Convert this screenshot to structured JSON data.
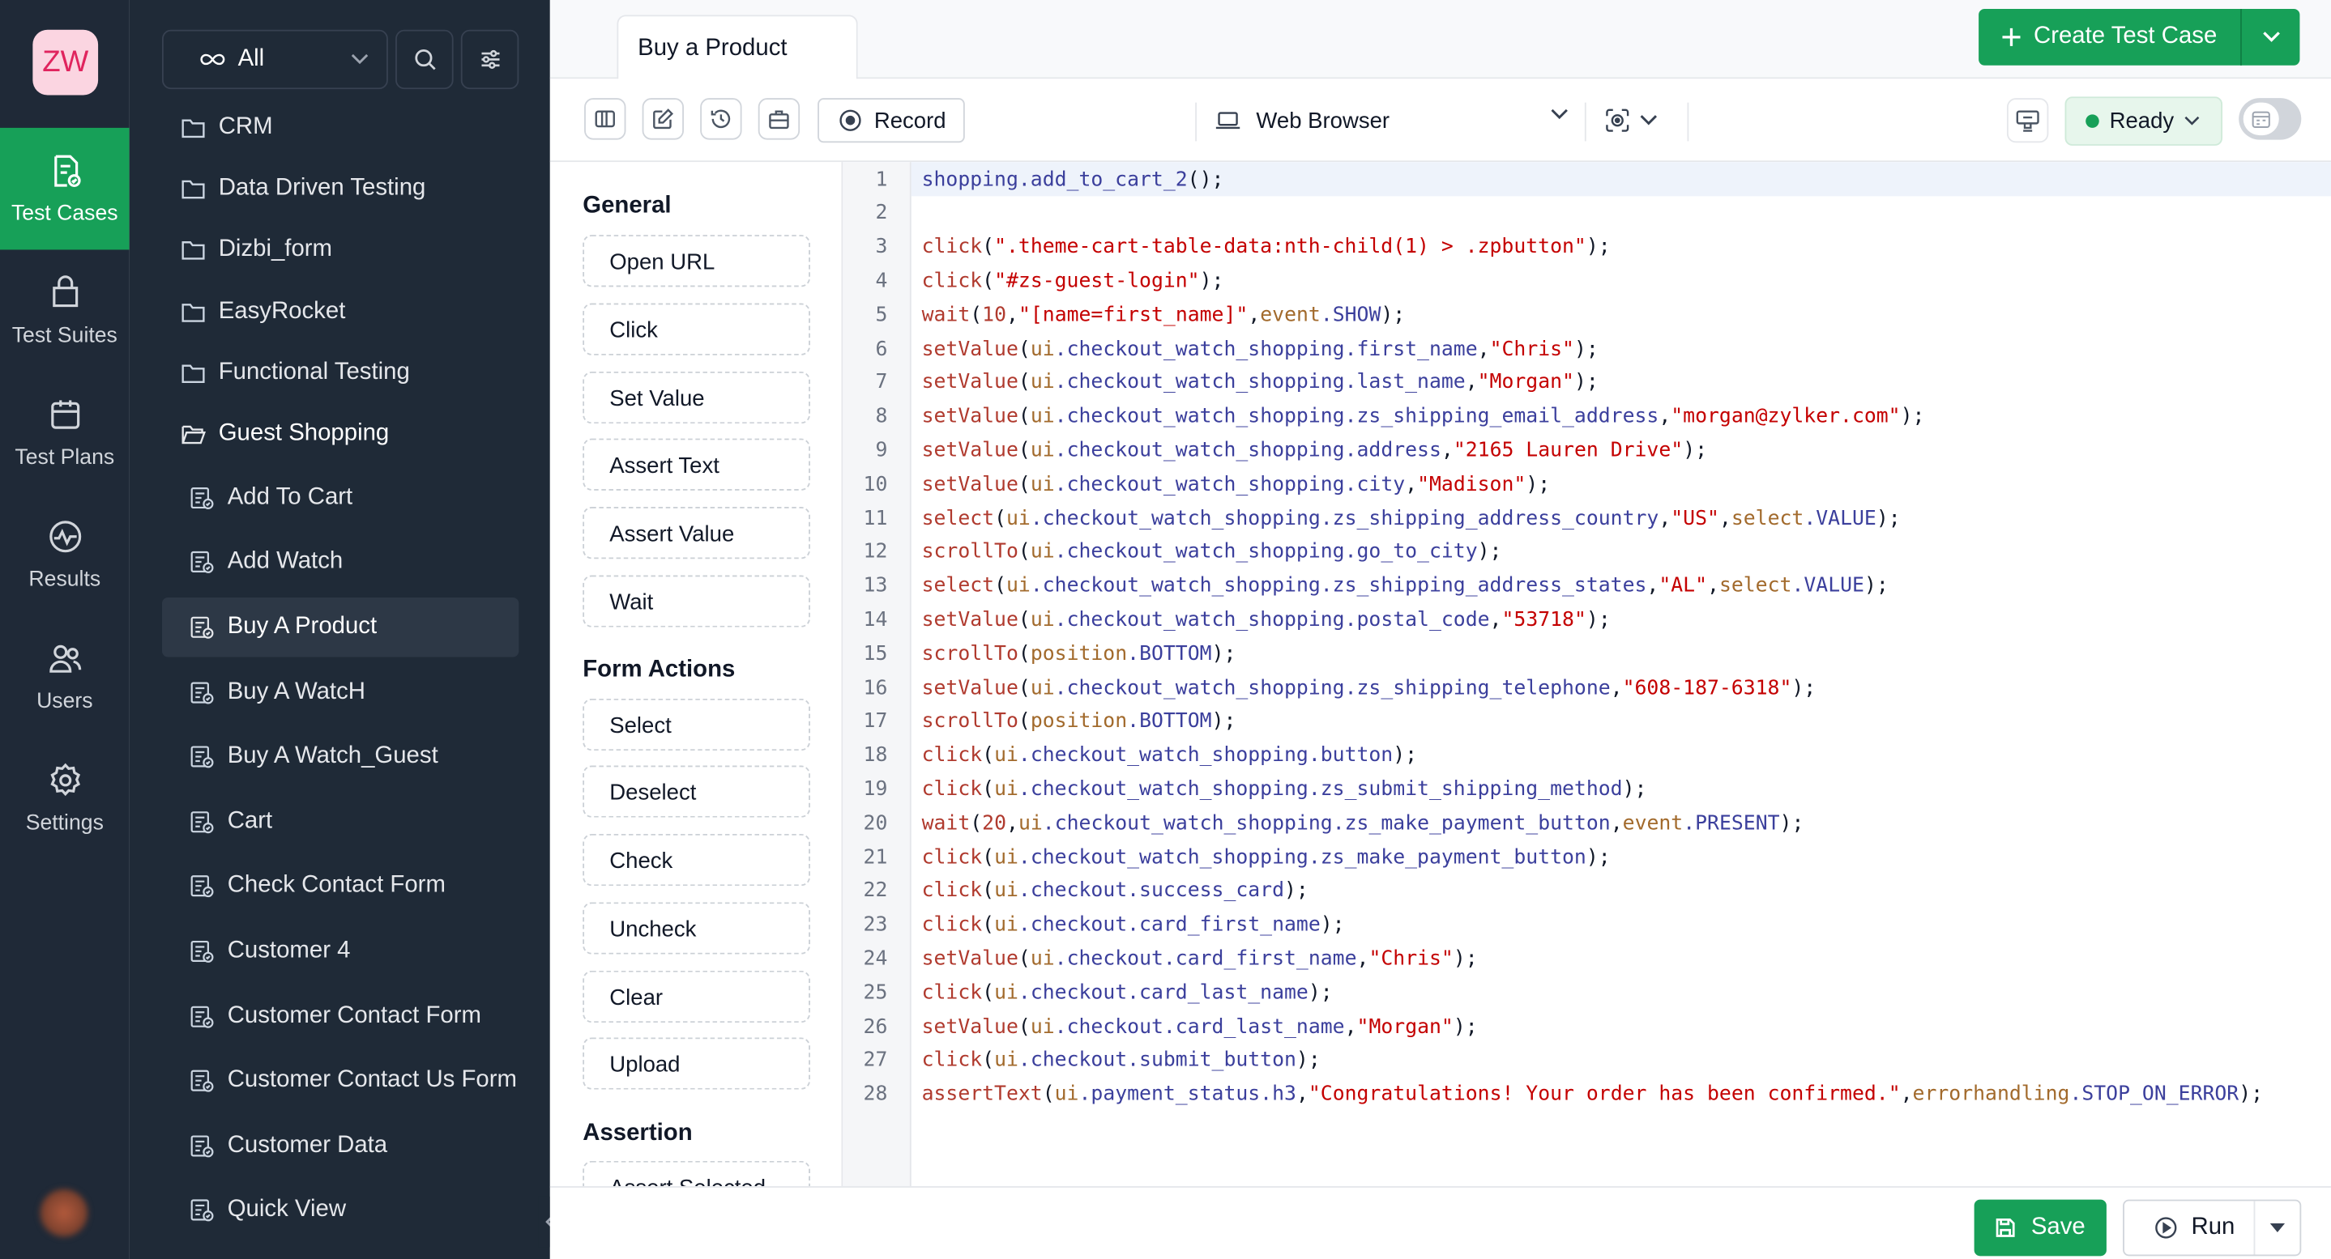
{
  "rail": {
    "logo_text": "ZW",
    "items": [
      {
        "label": "Test Cases",
        "icon": "test-cases-icon",
        "active": true
      },
      {
        "label": "Test Suites",
        "icon": "test-suites-icon",
        "active": false
      },
      {
        "label": "Test Plans",
        "icon": "test-plans-icon",
        "active": false
      },
      {
        "label": "Results",
        "icon": "results-icon",
        "active": false
      },
      {
        "label": "Users",
        "icon": "users-icon",
        "active": false
      },
      {
        "label": "Settings",
        "icon": "settings-icon",
        "active": false
      }
    ]
  },
  "tree": {
    "filter_label": "All",
    "folders": [
      {
        "label": "CRM",
        "open": false
      },
      {
        "label": "Data Driven Testing",
        "open": false
      },
      {
        "label": "Dizbi_form",
        "open": false
      },
      {
        "label": "EasyRocket",
        "open": false
      },
      {
        "label": "Functional Testing",
        "open": false
      },
      {
        "label": "Guest Shopping",
        "open": true
      }
    ],
    "cases": [
      {
        "label": "Add To Cart",
        "selected": false
      },
      {
        "label": "Add Watch",
        "selected": false
      },
      {
        "label": "Buy A Product",
        "selected": true
      },
      {
        "label": "Buy A WatcH",
        "selected": false
      },
      {
        "label": "Buy A Watch_Guest",
        "selected": false
      },
      {
        "label": "Cart",
        "selected": false
      },
      {
        "label": "Check Contact Form",
        "selected": false
      },
      {
        "label": "Customer 4",
        "selected": false
      },
      {
        "label": "Customer Contact Form",
        "selected": false
      },
      {
        "label": "Customer Contact Us Form",
        "selected": false
      },
      {
        "label": "Customer Data",
        "selected": false
      },
      {
        "label": "Quick View",
        "selected": false
      }
    ]
  },
  "header": {
    "tab_label": "Buy a Product",
    "create_label": "Create Test Case"
  },
  "toolbar": {
    "record_label": "Record",
    "browser_label": "Web Browser",
    "status_label": "Ready"
  },
  "palette": {
    "groups": [
      {
        "title": "General",
        "items": [
          "Open URL",
          "Click",
          "Set Value",
          "Assert Text",
          "Assert Value",
          "Wait"
        ]
      },
      {
        "title": "Form Actions",
        "items": [
          "Select",
          "Deselect",
          "Check",
          "Uncheck",
          "Clear",
          "Upload"
        ]
      },
      {
        "title": "Assertion",
        "items": [
          "Assert Selected"
        ]
      }
    ]
  },
  "editor": {
    "lines": [
      [
        [
          "shopping.add_to_cart_2",
          "p"
        ],
        [
          "();",
          "d"
        ]
      ],
      [],
      [
        [
          "click",
          "f"
        ],
        [
          "(",
          "d"
        ],
        [
          "\".theme-cart-table-data:nth-child(1) > .zpbutton\"",
          "s"
        ],
        [
          ");",
          "d"
        ]
      ],
      [
        [
          "click",
          "f"
        ],
        [
          "(",
          "d"
        ],
        [
          "\"#zs-guest-login\"",
          "s"
        ],
        [
          ");",
          "d"
        ]
      ],
      [
        [
          "wait",
          "f"
        ],
        [
          "(",
          "d"
        ],
        [
          "10",
          "n"
        ],
        [
          ",",
          "d"
        ],
        [
          "\"[name=first_name]\"",
          "s"
        ],
        [
          ",",
          "d"
        ],
        [
          "event",
          "o"
        ],
        [
          ".SHOW",
          "p"
        ],
        [
          ");",
          "d"
        ]
      ],
      [
        [
          "setValue",
          "f"
        ],
        [
          "(",
          "d"
        ],
        [
          "ui",
          "o"
        ],
        [
          ".checkout_watch_shopping.first_name",
          "p"
        ],
        [
          ",",
          "d"
        ],
        [
          "\"Chris\"",
          "s"
        ],
        [
          ");",
          "d"
        ]
      ],
      [
        [
          "setValue",
          "f"
        ],
        [
          "(",
          "d"
        ],
        [
          "ui",
          "o"
        ],
        [
          ".checkout_watch_shopping.last_name",
          "p"
        ],
        [
          ",",
          "d"
        ],
        [
          "\"Morgan\"",
          "s"
        ],
        [
          ");",
          "d"
        ]
      ],
      [
        [
          "setValue",
          "f"
        ],
        [
          "(",
          "d"
        ],
        [
          "ui",
          "o"
        ],
        [
          ".checkout_watch_shopping.zs_shipping_email_address",
          "p"
        ],
        [
          ",",
          "d"
        ],
        [
          "\"morgan@zylker.com\"",
          "s"
        ],
        [
          ");",
          "d"
        ]
      ],
      [
        [
          "setValue",
          "f"
        ],
        [
          "(",
          "d"
        ],
        [
          "ui",
          "o"
        ],
        [
          ".checkout_watch_shopping.address",
          "p"
        ],
        [
          ",",
          "d"
        ],
        [
          "\"2165 Lauren Drive\"",
          "s"
        ],
        [
          ");",
          "d"
        ]
      ],
      [
        [
          "setValue",
          "f"
        ],
        [
          "(",
          "d"
        ],
        [
          "ui",
          "o"
        ],
        [
          ".checkout_watch_shopping.city",
          "p"
        ],
        [
          ",",
          "d"
        ],
        [
          "\"Madison\"",
          "s"
        ],
        [
          ");",
          "d"
        ]
      ],
      [
        [
          "select",
          "f"
        ],
        [
          "(",
          "d"
        ],
        [
          "ui",
          "o"
        ],
        [
          ".checkout_watch_shopping.zs_shipping_address_country",
          "p"
        ],
        [
          ",",
          "d"
        ],
        [
          "\"US\"",
          "s"
        ],
        [
          ",",
          "d"
        ],
        [
          "select",
          "o"
        ],
        [
          ".VALUE",
          "p"
        ],
        [
          ");",
          "d"
        ]
      ],
      [
        [
          "scrollTo",
          "f"
        ],
        [
          "(",
          "d"
        ],
        [
          "ui",
          "o"
        ],
        [
          ".checkout_watch_shopping.go_to_city",
          "p"
        ],
        [
          ");",
          "d"
        ]
      ],
      [
        [
          "select",
          "f"
        ],
        [
          "(",
          "d"
        ],
        [
          "ui",
          "o"
        ],
        [
          ".checkout_watch_shopping.zs_shipping_address_states",
          "p"
        ],
        [
          ",",
          "d"
        ],
        [
          "\"AL\"",
          "s"
        ],
        [
          ",",
          "d"
        ],
        [
          "select",
          "o"
        ],
        [
          ".VALUE",
          "p"
        ],
        [
          ");",
          "d"
        ]
      ],
      [
        [
          "setValue",
          "f"
        ],
        [
          "(",
          "d"
        ],
        [
          "ui",
          "o"
        ],
        [
          ".checkout_watch_shopping.postal_code",
          "p"
        ],
        [
          ",",
          "d"
        ],
        [
          "\"53718\"",
          "s"
        ],
        [
          ");",
          "d"
        ]
      ],
      [
        [
          "scrollTo",
          "f"
        ],
        [
          "(",
          "d"
        ],
        [
          "position",
          "o"
        ],
        [
          ".BOTTOM",
          "p"
        ],
        [
          ");",
          "d"
        ]
      ],
      [
        [
          "setValue",
          "f"
        ],
        [
          "(",
          "d"
        ],
        [
          "ui",
          "o"
        ],
        [
          ".checkout_watch_shopping.zs_shipping_telephone",
          "p"
        ],
        [
          ",",
          "d"
        ],
        [
          "\"608-187-6318\"",
          "s"
        ],
        [
          ");",
          "d"
        ]
      ],
      [
        [
          "scrollTo",
          "f"
        ],
        [
          "(",
          "d"
        ],
        [
          "position",
          "o"
        ],
        [
          ".BOTTOM",
          "p"
        ],
        [
          ");",
          "d"
        ]
      ],
      [
        [
          "click",
          "f"
        ],
        [
          "(",
          "d"
        ],
        [
          "ui",
          "o"
        ],
        [
          ".checkout_watch_shopping.button",
          "p"
        ],
        [
          ");",
          "d"
        ]
      ],
      [
        [
          "click",
          "f"
        ],
        [
          "(",
          "d"
        ],
        [
          "ui",
          "o"
        ],
        [
          ".checkout_watch_shopping.zs_submit_shipping_method",
          "p"
        ],
        [
          ");",
          "d"
        ]
      ],
      [
        [
          "wait",
          "f"
        ],
        [
          "(",
          "d"
        ],
        [
          "20",
          "n"
        ],
        [
          ",",
          "d"
        ],
        [
          "ui",
          "o"
        ],
        [
          ".checkout_watch_shopping.zs_make_payment_button",
          "p"
        ],
        [
          ",",
          "d"
        ],
        [
          "event",
          "o"
        ],
        [
          ".PRESENT",
          "p"
        ],
        [
          ");",
          "d"
        ]
      ],
      [
        [
          "click",
          "f"
        ],
        [
          "(",
          "d"
        ],
        [
          "ui",
          "o"
        ],
        [
          ".checkout_watch_shopping.zs_make_payment_button",
          "p"
        ],
        [
          ");",
          "d"
        ]
      ],
      [
        [
          "click",
          "f"
        ],
        [
          "(",
          "d"
        ],
        [
          "ui",
          "o"
        ],
        [
          ".checkout.success_card",
          "p"
        ],
        [
          ");",
          "d"
        ]
      ],
      [
        [
          "click",
          "f"
        ],
        [
          "(",
          "d"
        ],
        [
          "ui",
          "o"
        ],
        [
          ".checkout.card_first_name",
          "p"
        ],
        [
          ");",
          "d"
        ]
      ],
      [
        [
          "setValue",
          "f"
        ],
        [
          "(",
          "d"
        ],
        [
          "ui",
          "o"
        ],
        [
          ".checkout.card_first_name",
          "p"
        ],
        [
          ",",
          "d"
        ],
        [
          "\"Chris\"",
          "s"
        ],
        [
          ");",
          "d"
        ]
      ],
      [
        [
          "click",
          "f"
        ],
        [
          "(",
          "d"
        ],
        [
          "ui",
          "o"
        ],
        [
          ".checkout.card_last_name",
          "p"
        ],
        [
          ");",
          "d"
        ]
      ],
      [
        [
          "setValue",
          "f"
        ],
        [
          "(",
          "d"
        ],
        [
          "ui",
          "o"
        ],
        [
          ".checkout.card_last_name",
          "p"
        ],
        [
          ",",
          "d"
        ],
        [
          "\"Morgan\"",
          "s"
        ],
        [
          ");",
          "d"
        ]
      ],
      [
        [
          "click",
          "f"
        ],
        [
          "(",
          "d"
        ],
        [
          "ui",
          "o"
        ],
        [
          ".checkout.submit_button",
          "p"
        ],
        [
          ");",
          "d"
        ]
      ],
      [
        [
          "assertText",
          "f"
        ],
        [
          "(",
          "d"
        ],
        [
          "ui",
          "o"
        ],
        [
          ".payment_status.h3",
          "p"
        ],
        [
          ",",
          "d"
        ],
        [
          "\"Congratulations! Your order has been confirmed.\"",
          "s"
        ],
        [
          ",",
          "d"
        ],
        [
          "errorhandling",
          "o"
        ],
        [
          ".STOP_ON_ERROR",
          "p"
        ],
        [
          ");",
          "d"
        ]
      ]
    ]
  },
  "footer": {
    "save_label": "Save",
    "run_label": "Run"
  },
  "colors": {
    "accent": "#17a058",
    "rail_bg": "#1f2937",
    "tree_bg": "#1f2a37",
    "code_function": "#b03a2e",
    "code_property": "#3b3f9c",
    "code_string": "#c40000",
    "code_object": "#a26a2c",
    "code_number": "#b03a2e",
    "code_default": "#111827"
  }
}
